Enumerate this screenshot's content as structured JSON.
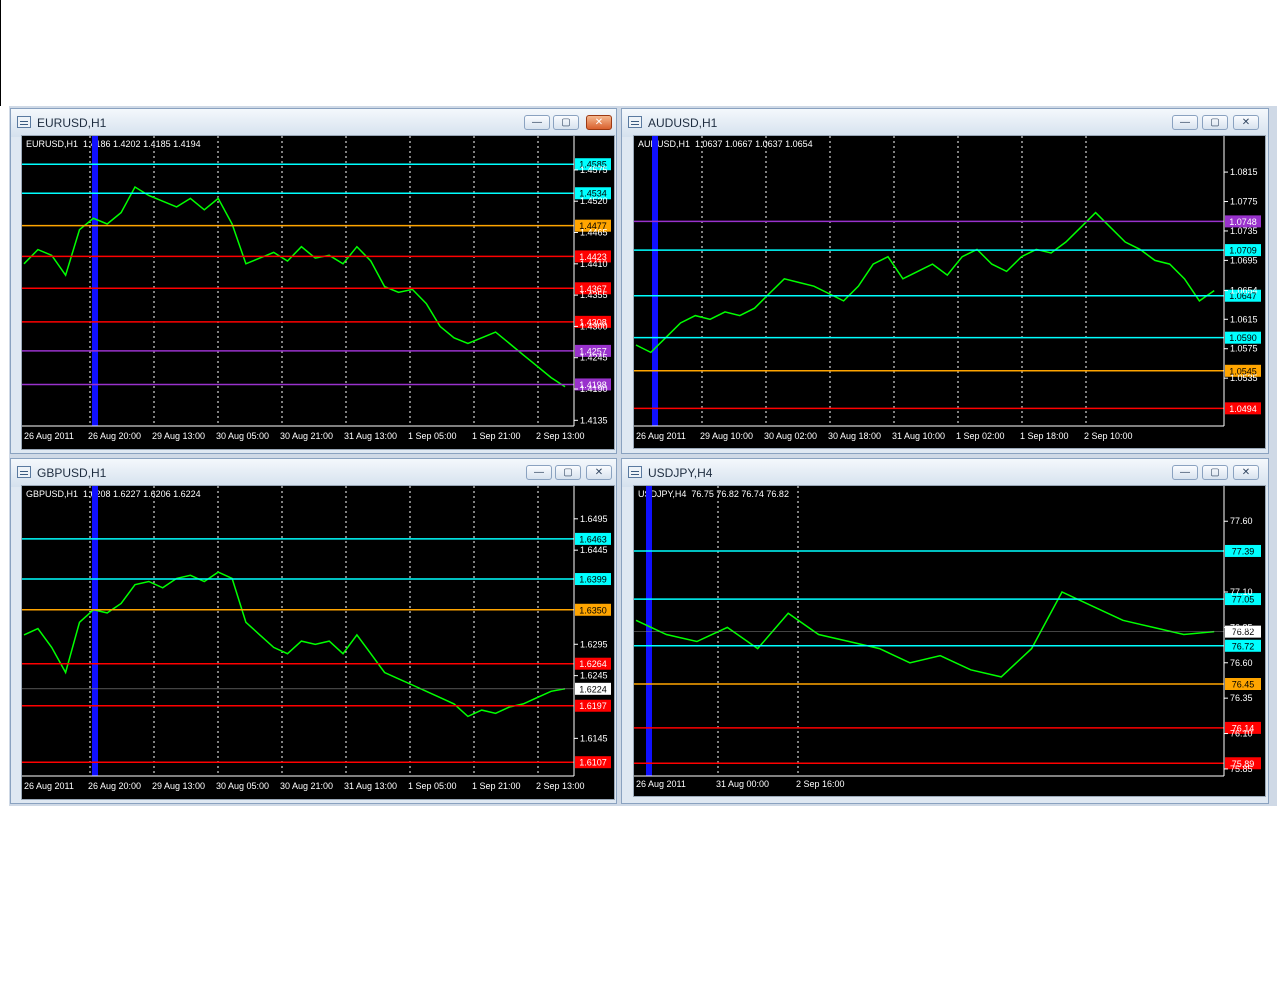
{
  "windows": [
    {
      "id": "eurusd",
      "title": "EURUSD,H1",
      "header": "EURUSD,H1  1.4186 1.4202 1.4185 1.4194",
      "close_active": true,
      "ymin": 4.13,
      "ymax": 4.16,
      "y_ticks": [
        "1.4575",
        "1.4520",
        "1.4465",
        "1.4410",
        "1.4355",
        "1.4300",
        "1.4245",
        "1.4190",
        "1.4135"
      ],
      "x_ticks": [
        "26 Aug 2011",
        "26 Aug 20:00",
        "29 Aug 13:00",
        "30 Aug 05:00",
        "30 Aug 21:00",
        "31 Aug 13:00",
        "1 Sep 05:00",
        "1 Sep 21:00",
        "2 Sep 13:00"
      ],
      "levels": [
        {
          "value": "1.4585",
          "color": "#00ffff"
        },
        {
          "value": "1.4534",
          "color": "#00ffff"
        },
        {
          "value": "1.4477",
          "color": "#ffa500"
        },
        {
          "value": "1.4423",
          "color": "#ff0000"
        },
        {
          "value": "1.4367",
          "color": "#ff0000"
        },
        {
          "value": "1.4308",
          "color": "#ff0000"
        },
        {
          "value": "1.4257",
          "color": "#9932cc"
        },
        {
          "value": "1.4198",
          "color": "#9932cc"
        }
      ],
      "price_path": [
        1.441,
        1.4435,
        1.4425,
        1.439,
        1.447,
        1.449,
        1.448,
        1.45,
        1.4545,
        1.453,
        1.452,
        1.451,
        1.4525,
        1.4505,
        1.4525,
        1.448,
        1.441,
        1.442,
        1.443,
        1.4415,
        1.444,
        1.442,
        1.4425,
        1.441,
        1.444,
        1.4415,
        1.437,
        1.436,
        1.4365,
        1.434,
        1.43,
        1.428,
        1.427,
        1.428,
        1.429,
        1.427,
        1.425,
        1.423,
        1.421,
        1.4194
      ]
    },
    {
      "id": "audusd",
      "title": "AUDUSD,H1",
      "header": "AUDUSD,H1  1.0637 1.0667 1.0637 1.0654",
      "close_active": false,
      "ymin": 1.047,
      "ymax": 1.0845,
      "y_ticks": [
        "1.0815",
        "1.0775",
        "1.0735",
        "1.0695",
        "1.0654",
        "1.0615",
        "1.0575",
        "1.0535"
      ],
      "x_ticks": [
        "26 Aug 2011",
        "29 Aug 10:00",
        "30 Aug 02:00",
        "30 Aug 18:00",
        "31 Aug 10:00",
        "1 Sep 02:00",
        "1 Sep 18:00",
        "2 Sep 10:00"
      ],
      "levels": [
        {
          "value": "1.0748",
          "color": "#9932cc"
        },
        {
          "value": "1.0709",
          "color": "#00ffff"
        },
        {
          "value": "1.0647",
          "color": "#00ffff"
        },
        {
          "value": "1.0590",
          "color": "#00ffff"
        },
        {
          "value": "1.0545",
          "color": "#ffa500"
        },
        {
          "value": "1.0494",
          "color": "#ff0000"
        }
      ],
      "price_path": [
        1.058,
        1.057,
        1.059,
        1.061,
        1.062,
        1.0615,
        1.0625,
        1.062,
        1.063,
        1.065,
        1.067,
        1.0665,
        1.066,
        1.065,
        1.064,
        1.066,
        1.069,
        1.07,
        1.067,
        1.068,
        1.069,
        1.0675,
        1.07,
        1.071,
        1.069,
        1.068,
        1.07,
        1.071,
        1.0705,
        1.072,
        1.074,
        1.076,
        1.074,
        1.072,
        1.071,
        1.0695,
        1.069,
        1.067,
        1.064,
        1.0654
      ]
    },
    {
      "id": "gbpusd",
      "title": "GBPUSD,H1",
      "header": "GBPUSD,H1  1.6208 1.6227 1.6206 1.6224",
      "close_active": false,
      "ymin": 1.6085,
      "ymax": 1.6525,
      "y_ticks": [
        "1.6495",
        "1.6445",
        "1.6295",
        "1.6245",
        "1.6145"
      ],
      "x_ticks": [
        "26 Aug 2011",
        "26 Aug 20:00",
        "29 Aug 13:00",
        "30 Aug 05:00",
        "30 Aug 21:00",
        "31 Aug 13:00",
        "1 Sep 05:00",
        "1 Sep 21:00",
        "2 Sep 13:00"
      ],
      "levels": [
        {
          "value": "1.6463",
          "color": "#00ffff"
        },
        {
          "value": "1.6399",
          "color": "#00ffff"
        },
        {
          "value": "1.6350",
          "color": "#ffa500"
        },
        {
          "value": "1.6264",
          "color": "#ff0000"
        },
        {
          "value": "1.6197",
          "color": "#ff0000"
        },
        {
          "value": "1.6107",
          "color": "#ff0000"
        },
        {
          "value": "1.6224",
          "color": "#ffffff"
        }
      ],
      "price_path": [
        1.631,
        1.632,
        1.629,
        1.625,
        1.633,
        1.635,
        1.6345,
        1.636,
        1.639,
        1.6395,
        1.6385,
        1.64,
        1.6405,
        1.6395,
        1.641,
        1.64,
        1.633,
        1.631,
        1.629,
        1.628,
        1.63,
        1.6295,
        1.63,
        1.628,
        1.631,
        1.628,
        1.625,
        1.624,
        1.623,
        1.622,
        1.621,
        1.62,
        1.618,
        1.619,
        1.6185,
        1.6195,
        1.62,
        1.621,
        1.622,
        1.6224
      ]
    },
    {
      "id": "usdjpy",
      "title": "USDJPY,H4",
      "header": "USDJPY,H4  76.75 76.82 76.74 76.82",
      "close_active": false,
      "ymin": 75.8,
      "ymax": 77.75,
      "y_ticks": [
        "77.60",
        "77.10",
        "76.85",
        "76.60",
        "76.35",
        "76.10",
        "75.85"
      ],
      "x_ticks": [
        "26 Aug 2011",
        "31 Aug 00:00",
        "2 Sep 16:00"
      ],
      "levels": [
        {
          "value": "77.39",
          "color": "#00ffff"
        },
        {
          "value": "77.05",
          "color": "#00ffff"
        },
        {
          "value": "76.72",
          "color": "#00ffff"
        },
        {
          "value": "76.45",
          "color": "#ffa500"
        },
        {
          "value": "76.14",
          "color": "#ff0000"
        },
        {
          "value": "75.89",
          "color": "#ff0000"
        },
        {
          "value": "76.82",
          "color": "#ffffff"
        }
      ],
      "price_path": [
        76.9,
        76.8,
        76.75,
        76.85,
        76.7,
        76.95,
        76.8,
        76.75,
        76.7,
        76.6,
        76.65,
        76.55,
        76.5,
        76.7,
        77.1,
        77.0,
        76.9,
        76.85,
        76.8,
        76.82
      ]
    }
  ]
}
